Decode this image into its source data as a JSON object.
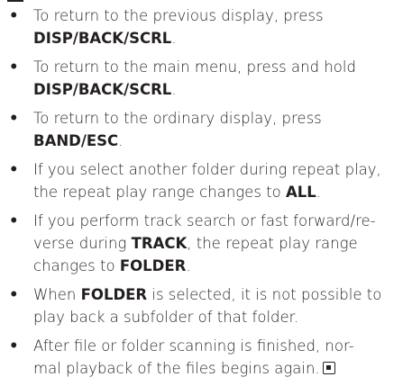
{
  "bullet_symbol": "•",
  "end_mark_icon": "end-of-section-icon",
  "items": [
    [
      {
        "text": "To return to the previous display, press",
        "bold": false
      },
      {
        "br": true
      },
      {
        "text": "DISP/BACK/SCRL",
        "bold": true
      },
      {
        "text": ".",
        "bold": false
      }
    ],
    [
      {
        "text": "To return to the main menu, press and hold",
        "bold": false
      },
      {
        "br": true
      },
      {
        "text": "DISP/BACK/SCRL",
        "bold": true
      },
      {
        "text": ".",
        "bold": false
      }
    ],
    [
      {
        "text": "To return to the ordinary display, press",
        "bold": false
      },
      {
        "br": true
      },
      {
        "text": "BAND/ESC",
        "bold": true
      },
      {
        "text": ".",
        "bold": false
      }
    ],
    [
      {
        "text": "If you select another folder during repeat play,",
        "bold": false
      },
      {
        "br": true
      },
      {
        "text": "the repeat play range changes to ",
        "bold": false
      },
      {
        "text": "ALL",
        "bold": true
      },
      {
        "text": ".",
        "bold": false
      }
    ],
    [
      {
        "text": "If you perform track search or fast forward/re-",
        "bold": false
      },
      {
        "br": true
      },
      {
        "text": "verse during ",
        "bold": false
      },
      {
        "text": "TRACK",
        "bold": true
      },
      {
        "text": ", the repeat play range",
        "bold": false
      },
      {
        "br": true
      },
      {
        "text": "changes to ",
        "bold": false
      },
      {
        "text": "FOLDER",
        "bold": true
      },
      {
        "text": ".",
        "bold": false
      }
    ],
    [
      {
        "text": "When ",
        "bold": false
      },
      {
        "text": "FOLDER",
        "bold": true
      },
      {
        "text": " is selected, it is not possible to",
        "bold": false
      },
      {
        "br": true
      },
      {
        "text": "play back a subfolder of that folder.",
        "bold": false
      }
    ],
    [
      {
        "text": "After file or folder scanning is finished, nor-",
        "bold": false
      },
      {
        "br": true
      },
      {
        "text": "mal playback of the files begins again.",
        "bold": false
      },
      {
        "icon": "end-of-section-icon"
      }
    ]
  ]
}
